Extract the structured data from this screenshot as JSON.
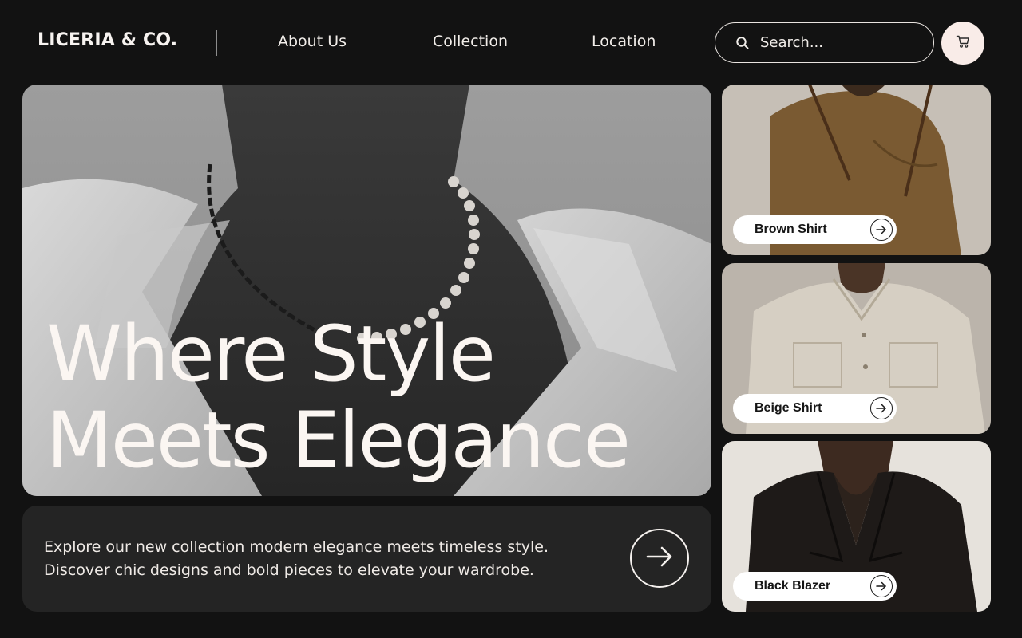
{
  "header": {
    "brand": "LICERIA & CO.",
    "nav": [
      "About Us",
      "Collection",
      "Location"
    ],
    "search_placeholder": "Search...",
    "search_icon": "search-icon",
    "cart_icon": "cart-icon"
  },
  "hero": {
    "title_line1": "Where Style",
    "title_line2": "Meets Elegance"
  },
  "promo": {
    "line1": "Explore our new collection modern elegance meets timeless style.",
    "line2": "Discover chic designs and bold pieces to elevate your wardrobe.",
    "arrow_icon": "arrow-right-icon"
  },
  "products": [
    {
      "name": "Brown Shirt"
    },
    {
      "name": "Beige Shirt"
    },
    {
      "name": "Black Blazer"
    }
  ],
  "colors": {
    "background": "#121212",
    "panel": "#242424",
    "cart_button": "#f9ece8",
    "text_light": "#f5f1ee"
  }
}
